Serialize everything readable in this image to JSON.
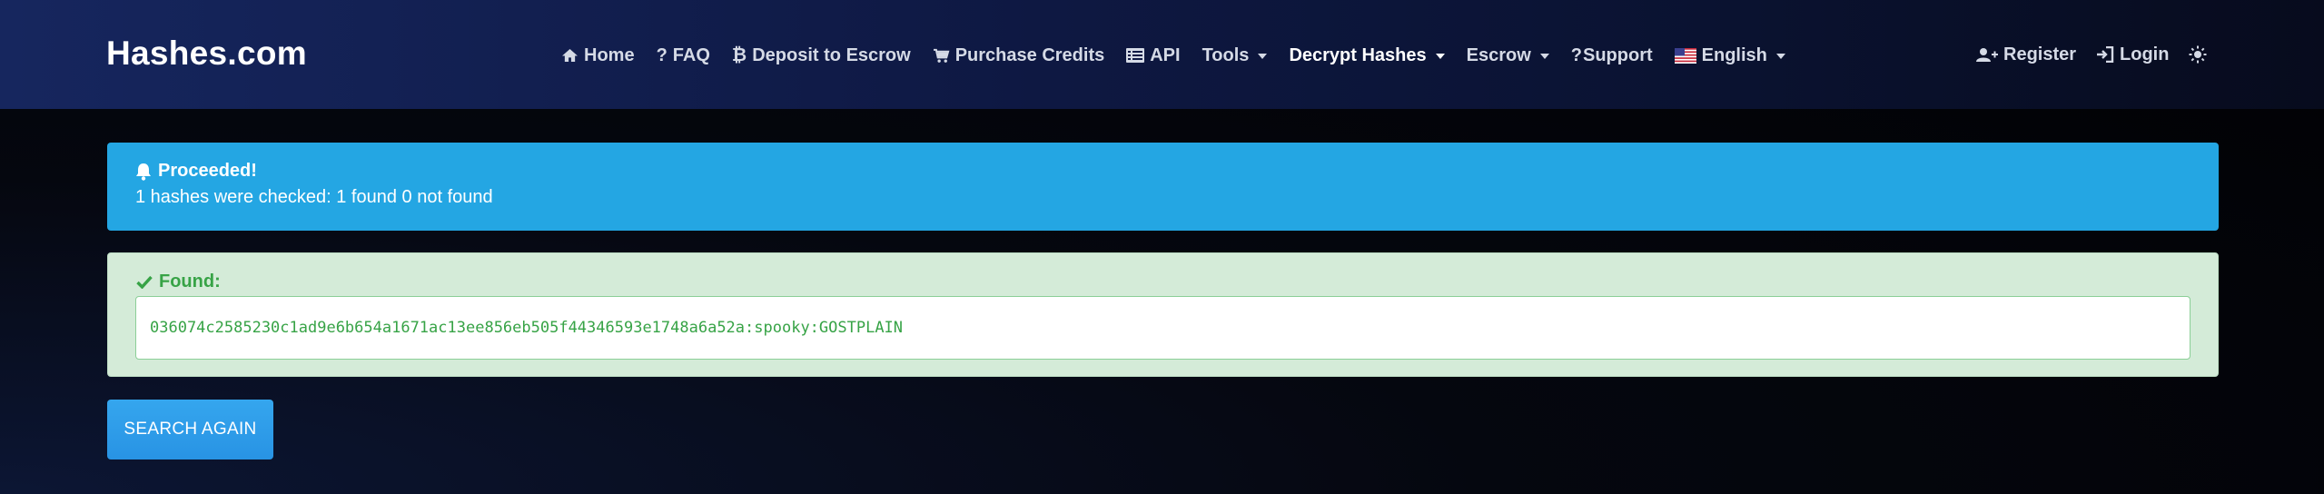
{
  "brand": "Hashes.com",
  "nav": {
    "home": "Home",
    "faq": "FAQ",
    "deposit": "Deposit to Escrow",
    "purchase": "Purchase Credits",
    "api": "API",
    "tools": "Tools",
    "decrypt": "Decrypt Hashes",
    "escrow": "Escrow",
    "support": "Support",
    "language": "English",
    "faq_icon": "?",
    "support_icon": "?",
    "bitcoin_icon": "₿"
  },
  "auth": {
    "register": "Register",
    "login": "Login"
  },
  "alert": {
    "title": "Proceeded!",
    "message": "1 hashes were checked: 1 found 0 not found"
  },
  "found": {
    "label": "Found:",
    "result": "036074c2585230c1ad9e6b654a1671ac13ee856eb505f44346593e1748a6a52a:spooky:GOSTPLAIN"
  },
  "search_again": "SEARCH AGAIN",
  "colors": {
    "info": "#24a6e3",
    "success_bg": "#d4ebd8",
    "success_text": "#37a346",
    "button": "#2a96e6"
  }
}
